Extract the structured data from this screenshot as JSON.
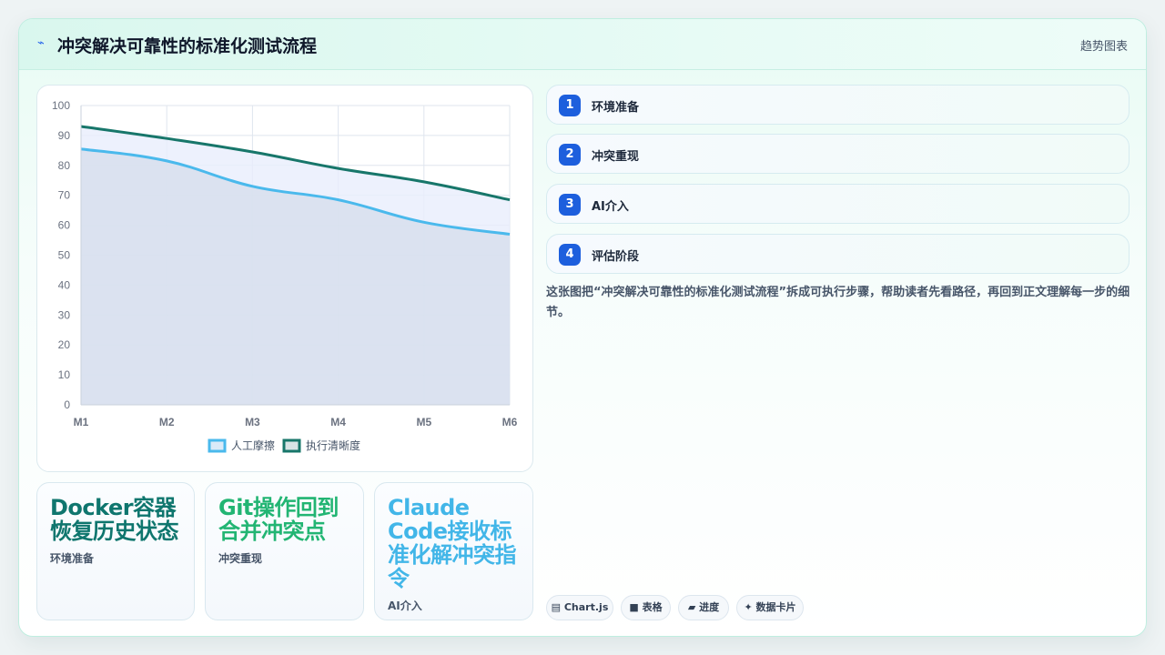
{
  "header": {
    "icon": "chart-line-icon",
    "title": "冲突解决可靠性的标准化测试流程",
    "tag": "趋势图表"
  },
  "chart_data": {
    "type": "line",
    "categories": [
      "M1",
      "M2",
      "M3",
      "M4",
      "M5",
      "M6"
    ],
    "series": [
      {
        "name": "人工摩擦",
        "values": [
          85.5,
          81.5,
          73,
          68.5,
          61,
          57
        ],
        "color": "#4ab9ec",
        "fill": true
      },
      {
        "name": "执行清晰度",
        "values": [
          93,
          89,
          84.5,
          79,
          74.5,
          68.5
        ],
        "color": "#17766a",
        "fill": true
      }
    ],
    "ylim": [
      0,
      100
    ],
    "yticks": [
      0,
      10,
      20,
      30,
      40,
      50,
      60,
      70,
      80,
      90,
      100
    ],
    "grid": true,
    "legend": "bottom"
  },
  "cards": [
    {
      "big": "Docker容器恢复历史状态",
      "sub": "环境准备",
      "color": "#0f766e"
    },
    {
      "big": "Git操作回到合并冲突点",
      "sub": "冲突重现",
      "color": "#22b573"
    },
    {
      "big": "Claude Code接收标准化解冲突指令",
      "sub": "AI介入",
      "color": "#42b6e8"
    }
  ],
  "steps": [
    {
      "num": "1",
      "label": "环境准备"
    },
    {
      "num": "2",
      "label": "冲突重现"
    },
    {
      "num": "3",
      "label": "AI介入"
    },
    {
      "num": "4",
      "label": "评估阶段"
    }
  ],
  "description": "这张图把“冲突解决可靠性的标准化测试流程”拆成可执行步骤，帮助读者先看路径，再回到正文理解每一步的细节。",
  "chips": [
    {
      "icon": "chart-icon",
      "glyph": "▤",
      "label": "Chart.js"
    },
    {
      "icon": "table-icon",
      "glyph": "■",
      "label": "表格"
    },
    {
      "icon": "progress-icon",
      "glyph": "▰",
      "label": "进度"
    },
    {
      "icon": "sparkle-icon",
      "glyph": "✦",
      "label": "数据卡片"
    }
  ]
}
